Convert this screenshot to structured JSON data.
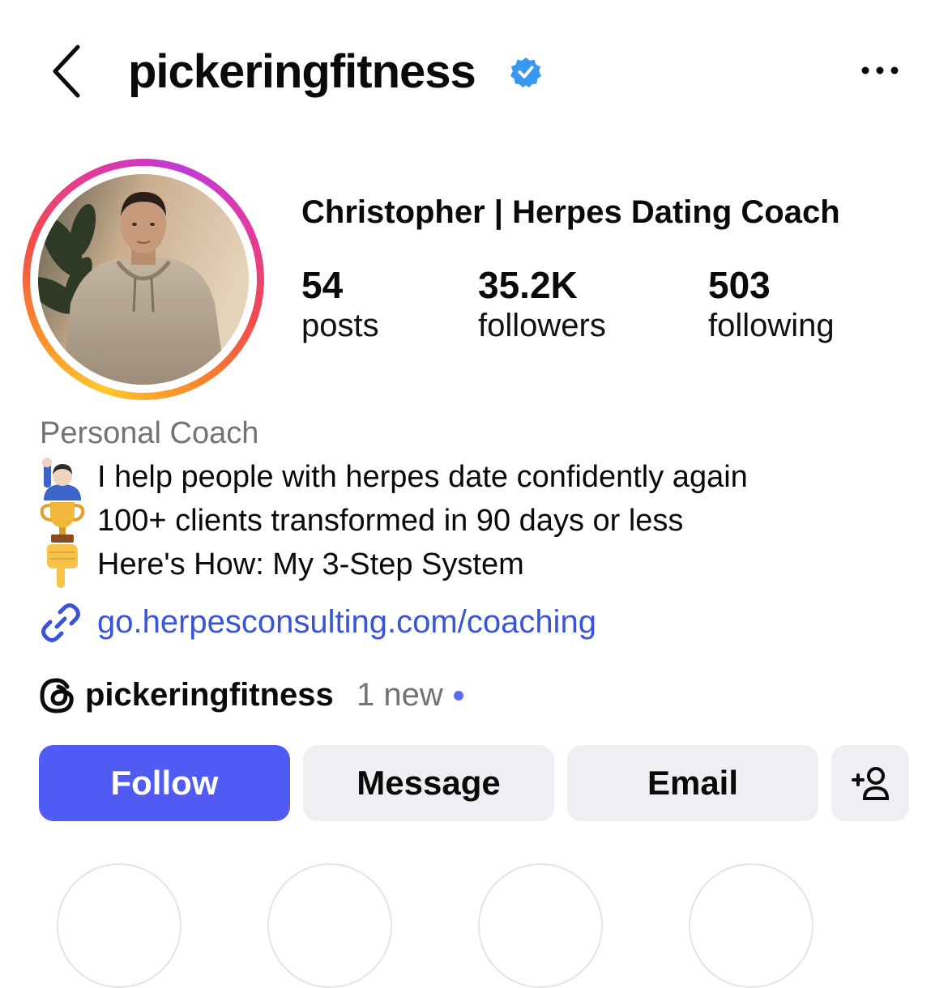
{
  "header": {
    "username": "pickeringfitness",
    "verified": true,
    "back_icon": "chevron-left-icon",
    "more_icon": "more-horizontal-icon"
  },
  "profile": {
    "display_name": "Christopher | Herpes Dating Coach",
    "stats": [
      {
        "value": "54",
        "label": "posts"
      },
      {
        "value": "35.2K",
        "label": "followers"
      },
      {
        "value": "503",
        "label": "following"
      }
    ]
  },
  "bio": {
    "category": "Personal Coach",
    "lines": [
      {
        "icon": "raising-hand-emoji",
        "text": "I help people with herpes date confidently again"
      },
      {
        "icon": "trophy-emoji",
        "text": "100+ clients transformed in 90 days or less"
      },
      {
        "icon": "pointing-down-emoji",
        "text": "Here's How: My 3-Step System"
      }
    ],
    "link": "go.herpesconsulting.com/coaching"
  },
  "threads": {
    "handle": "pickeringfitness",
    "badge": "1 new"
  },
  "actions": {
    "follow": "Follow",
    "message": "Message",
    "email": "Email",
    "add_user_icon": "add-person-icon"
  },
  "colors": {
    "primary": "#4f5bf3",
    "link": "#3a54d6",
    "verified": "#3897f0",
    "secondary_text": "#737373",
    "button_bg": "#efeff3"
  }
}
